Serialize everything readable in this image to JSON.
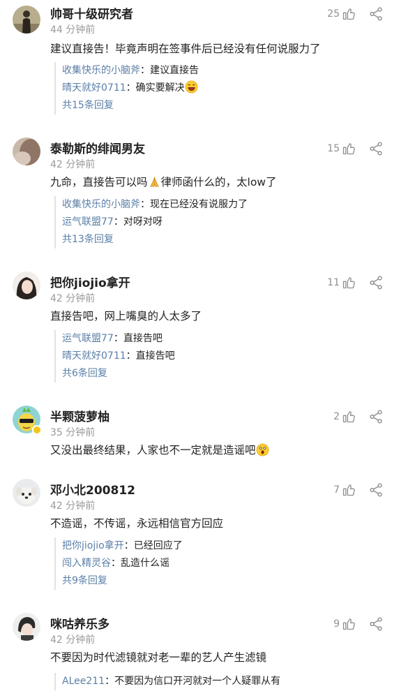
{
  "comments": [
    {
      "username": "帅哥十级研究者",
      "time": "44 分钟前",
      "likes": "25",
      "text_pre": "建议直接告！毕竟声明在签事件后已经没有任何说服力了",
      "text_post": "",
      "replies": [
        {
          "name": "收集快乐的小脑斧",
          "sep": "：",
          "text": "建议直接告",
          "emoji": ""
        },
        {
          "name": "晴天就好0711",
          "sep": "：",
          "text": "确实要解决",
          "emoji": "laughing-emoji"
        }
      ],
      "more": "共15条回复"
    },
    {
      "username": "泰勒斯的绯闻男友",
      "time": "42 分钟前",
      "likes": "15",
      "text_pre": "九命，直接告可以吗",
      "emoji": "pray-emoji",
      "text_post": "律师函什么的，太low了",
      "replies": [
        {
          "name": "收集快乐的小脑斧",
          "sep": "：",
          "text": "现在已经没有说服力了",
          "emoji": ""
        },
        {
          "name": "运气联盟77",
          "sep": "：",
          "text": "对呀对呀",
          "emoji": ""
        }
      ],
      "more": "共13条回复"
    },
    {
      "username": "把你jiojio拿开",
      "time": "42 分钟前",
      "likes": "11",
      "text_pre": "直接告吧，网上嘴臭的人太多了",
      "text_post": "",
      "replies": [
        {
          "name": "运气联盟77",
          "sep": "：",
          "text": "直接告吧",
          "emoji": ""
        },
        {
          "name": "晴天就好0711",
          "sep": "：",
          "text": "直接告吧",
          "emoji": ""
        }
      ],
      "more": "共6条回复"
    },
    {
      "username": "半颗菠萝柚",
      "time": "35 分钟前",
      "likes": "2",
      "text_pre": "又没出最终结果，人家也不一定就是造谣吧",
      "emoji": "surprised-emoji",
      "text_post": "",
      "replies": [],
      "more": ""
    },
    {
      "username": "邓小北200812",
      "time": "42 分钟前",
      "likes": "7",
      "text_pre": "不造谣，不传谣，永远相信官方回应",
      "text_post": "",
      "replies": [
        {
          "name": "把你jiojio拿开",
          "sep": "：",
          "text": "已经回应了",
          "emoji": ""
        },
        {
          "name": "闯入精灵谷",
          "sep": "：",
          "text": "乱造什么谣",
          "emoji": ""
        }
      ],
      "more": "共9条回复"
    },
    {
      "username": "咪咕养乐多",
      "time": "42 分钟前",
      "likes": "9",
      "text_pre": "不要因为时代滤镜就对老一辈的艺人产生滤镜",
      "text_post": "",
      "replies": [
        {
          "name": "ALee211",
          "sep": "：",
          "text": "不要因为信口开河就对一个人疑罪从有",
          "emoji": ""
        }
      ],
      "more": ""
    }
  ],
  "colors": {
    "name_link": "#5b7fa8",
    "muted": "#9a9a9a",
    "text": "#222222"
  },
  "icons": {
    "like": "thumbs-up-icon",
    "share": "share-icon"
  }
}
